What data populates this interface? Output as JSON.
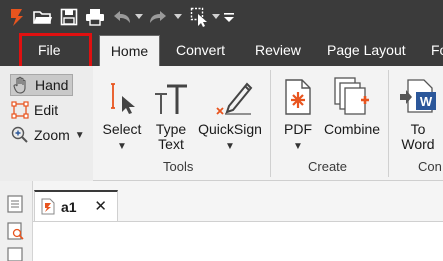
{
  "titlebar": {
    "icons": [
      "app-logo-icon",
      "open-folder-icon",
      "save-icon",
      "print-icon",
      "undo-icon",
      "dropdown-caret-icon",
      "redo-icon",
      "dropdown-caret-icon",
      "select-cursor-icon",
      "customize-toolbar-icon"
    ]
  },
  "tabs": {
    "file": "File",
    "home": "Home",
    "convert": "Convert",
    "review": "Review",
    "page_layout": "Page Layout",
    "fo": "Fo"
  },
  "left_panel": {
    "hand": "Hand",
    "edit": "Edit",
    "zoom": "Zoom"
  },
  "ribbon": {
    "select": "Select",
    "type_text_line1": "Type",
    "type_text_line2": "Text",
    "quicksign": "QuickSign",
    "tools_label": "Tools",
    "pdf": "PDF",
    "combine": "Combine",
    "create_label": "Create",
    "to_word_line1": "To",
    "to_word_line2": "Word",
    "con_label": "Con"
  },
  "doc_tab": {
    "label": "a1",
    "close": "✕"
  },
  "colors": {
    "titlebar_bg": "#3b3b3b",
    "accent_orange": "#e8541e",
    "highlight_red": "#e01010",
    "word_blue": "#2b579a"
  }
}
